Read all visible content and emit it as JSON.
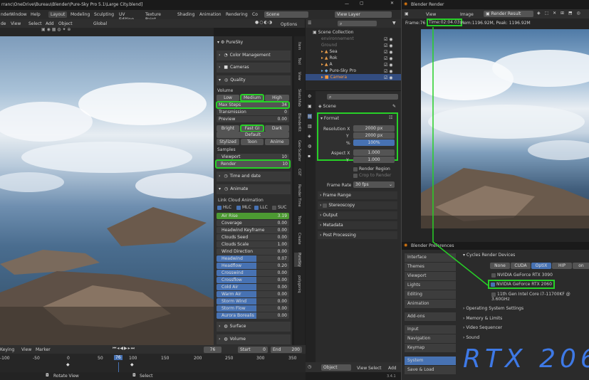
{
  "titlebar": {
    "path": "rranc\\OneDrive\\Bureau\\Blender\\Pure-Sky Pro 5.1\\Large City.blend]"
  },
  "menu": [
    "nder",
    "Window",
    "Help"
  ],
  "workspace_tabs": [
    "Layout",
    "Modeling",
    "Sculpting",
    "UV Editing",
    "Texture Paint",
    "Shading",
    "Animation",
    "Rendering",
    "Co"
  ],
  "scene_field": "Scene",
  "view_layer_field": "View Layer",
  "viewport_header": {
    "items": [
      "de",
      "View",
      "Select",
      "Add",
      "Object"
    ],
    "orientation": "Global",
    "options": "Options"
  },
  "sidepanel": {
    "title": "PureSky",
    "sections": {
      "color": "Color Management",
      "cameras": "Cameras",
      "quality": "Quality",
      "time": "Time and date",
      "animate": "Animate",
      "surface": "Surface",
      "volume": "Volume"
    },
    "volume_label": "Volume",
    "volume_buttons": [
      "Low",
      "Medium",
      "High"
    ],
    "max_steps": {
      "label": "Max Steps",
      "value": "34"
    },
    "transmission": {
      "label": "Transmission",
      "value": "0"
    },
    "preview": {
      "label": "Preview",
      "value": "0.00"
    },
    "gi_buttons": [
      "Bright",
      "Fast GI",
      "Dark"
    ],
    "default_label": "Default",
    "style_buttons": [
      "Stylized",
      "Toon",
      "Anime"
    ],
    "samples_label": "Samples",
    "viewport": {
      "label": "Viewport",
      "value": "10"
    },
    "render": {
      "label": "Render",
      "value": "10"
    },
    "link_label": "Link Cloud Animation",
    "links": [
      "HLC",
      "MLC",
      "LLC",
      "SUC"
    ],
    "anim_rows": [
      {
        "label": "Air Rise",
        "value": "3.19"
      },
      {
        "label": "Coverage",
        "value": "0.00"
      },
      {
        "label": "Headwind Keyframe",
        "value": "0.00"
      },
      {
        "label": "Clouds Seed",
        "value": "0.00"
      },
      {
        "label": "Clouds Scale",
        "value": "1.00"
      },
      {
        "label": "Wind Direction",
        "value": "0.00"
      },
      {
        "label": "Headwind",
        "value": "0.07"
      },
      {
        "label": "Headflow",
        "value": "0.20"
      },
      {
        "label": "Crosswind",
        "value": "0.00"
      },
      {
        "label": "Crossflow",
        "value": "0.00"
      },
      {
        "label": "Cold Air",
        "value": "0.00"
      },
      {
        "label": "Warm Air",
        "value": "0.00"
      },
      {
        "label": "Storm Wind",
        "value": "0.00"
      },
      {
        "label": "Storm Flow",
        "value": "0.00"
      },
      {
        "label": "Aurora Borealis",
        "value": "0.00"
      }
    ]
  },
  "vertical_tabs": [
    "Item",
    "Tool",
    "View",
    "Sketchfab",
    "BlenderKit",
    "Geo-Scatter",
    "CGT",
    "Render Time",
    "Tools",
    "Create",
    "PureSky",
    "polygoniq"
  ],
  "outliner": {
    "root": "Scene Collection",
    "items": [
      "environnement",
      "Ground",
      "Sea",
      "Rok",
      "A",
      "Pure-Sky Pro",
      "Camera"
    ]
  },
  "properties": {
    "scene": "Scene",
    "format_title": "Format",
    "resolution_x": {
      "label": "Resolution X",
      "value": "2000 px"
    },
    "resolution_y": {
      "label": "Y",
      "value": "2000 px"
    },
    "percent": {
      "label": "%",
      "value": "100%"
    },
    "aspect_x": {
      "label": "Aspect X",
      "value": "1.000"
    },
    "aspect_y": {
      "label": "Y",
      "value": "1.000"
    },
    "render_region": "Render Region",
    "crop": "Crop to Render",
    "frame_rate": {
      "label": "Frame Rate",
      "value": "30 fps"
    },
    "collapsed": [
      "Frame Range",
      "Stereoscopy",
      "Output",
      "Metadata",
      "Post Processing"
    ]
  },
  "props_footer": {
    "mode": "Object",
    "items": [
      "View",
      "Select",
      "Add"
    ],
    "version": "3.4.1"
  },
  "timeline": {
    "header": [
      "Keying",
      "View",
      "Marker"
    ],
    "current_frame": "76",
    "start_label": "Start",
    "start": "0",
    "end_label": "End",
    "end": "200",
    "ruler": [
      "-100",
      "-50",
      "0",
      "50",
      "76",
      "100",
      "150",
      "200",
      "250",
      "300",
      "350"
    ]
  },
  "statusbar": {
    "rotate": "Rotate View",
    "select": "Select"
  },
  "render_window": {
    "title": "Blender Render",
    "menu": [
      "View",
      "Image"
    ],
    "slot": "Render Result",
    "frame": "Frame:76",
    "time": "Time:02:04.03",
    "mem": "Mem:1196.92M, Peak: 1196.92M"
  },
  "prefs": {
    "title": "Blender Preferences",
    "nav1": [
      "Interface",
      "Themes",
      "Viewport",
      "Lights",
      "Editing",
      "Animation"
    ],
    "nav2": [
      "Add-ons"
    ],
    "nav3": [
      "Input",
      "Navigation",
      "Keymap"
    ],
    "nav4": [
      "System",
      "Save & Load"
    ],
    "devices_title": "Cycles Render Devices",
    "device_tabs": [
      "None",
      "CUDA",
      "OptiX",
      "HIP",
      "on"
    ],
    "devices": [
      {
        "name": "NVIDIA GeForce RTX 3090",
        "checked": false
      },
      {
        "name": "NVIDIA GeForce RTX 2060",
        "checked": true
      },
      {
        "name": "11th Gen Intel Core i7-11700KF @ 3.60GHz",
        "checked": false
      }
    ],
    "sections": [
      "Operating System Settings",
      "Memory & Limits",
      "Video Sequencer",
      "Sound"
    ]
  },
  "handwriting": "RTX 206",
  "colors": {
    "highlight": "#27d027",
    "accent": "#4772b3",
    "green_bar": "#4c9a32"
  }
}
